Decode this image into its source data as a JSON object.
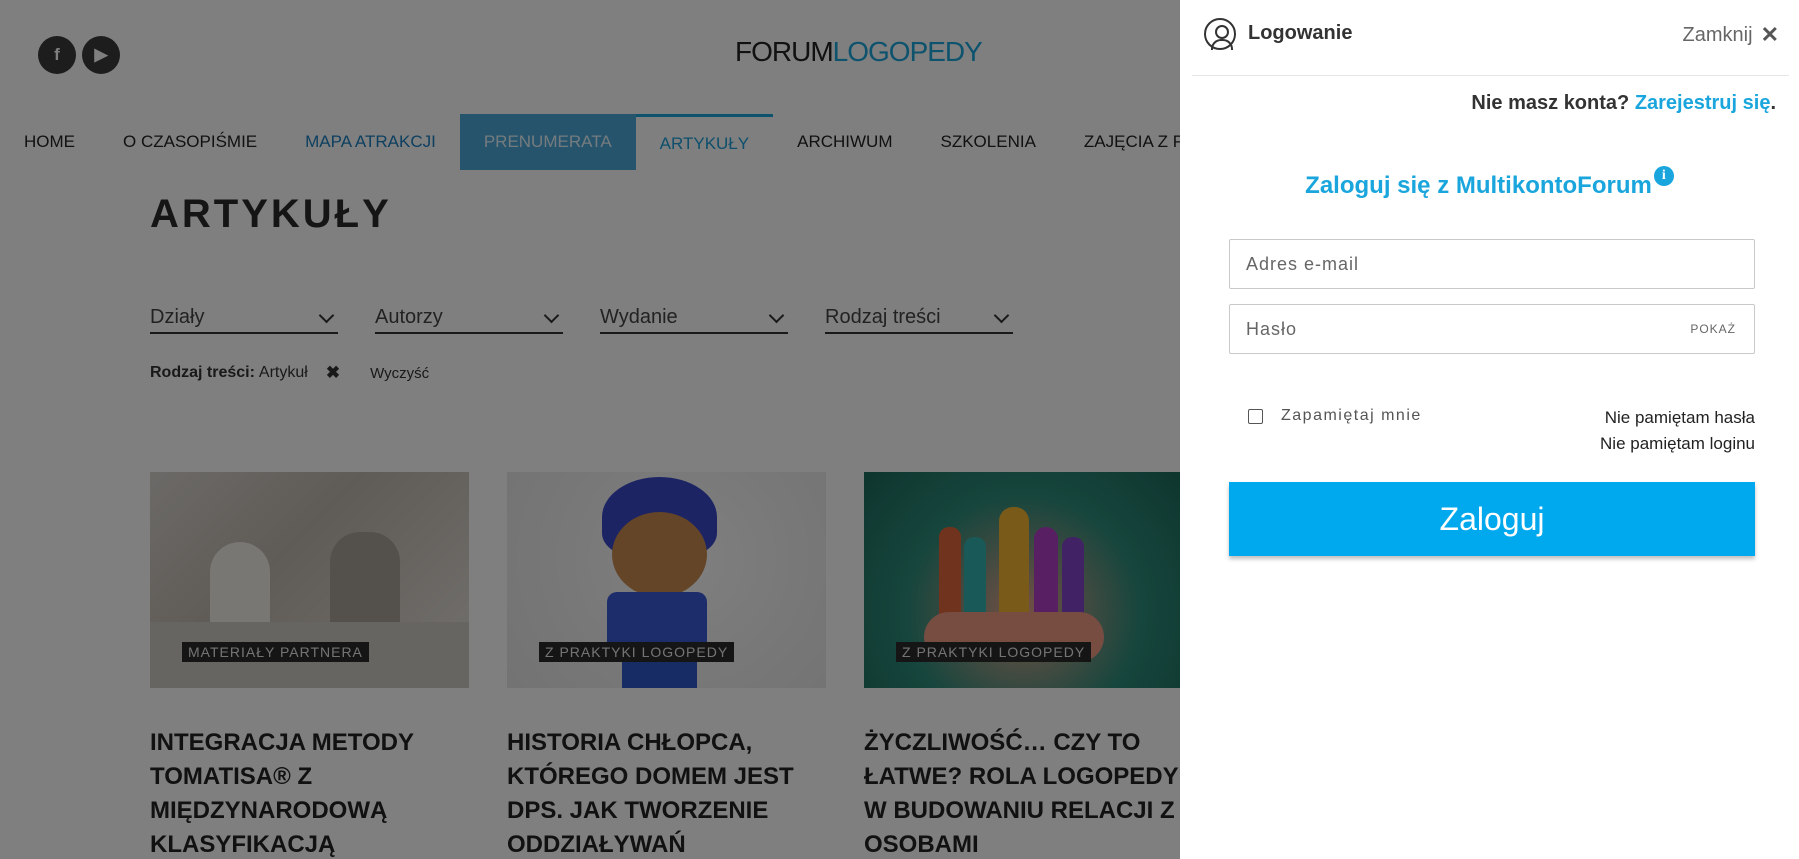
{
  "site": {
    "social": [
      {
        "icon": "facebook-icon",
        "glyph": "f"
      },
      {
        "icon": "youtube-icon",
        "glyph": "▶"
      }
    ],
    "logo": {
      "part1": "FORUM",
      "part2": "LOGOPEDY"
    },
    "nav": [
      "HOME",
      "O CZASOPIŚMIE",
      "MAPA ATRAKCJI",
      "PRENUMERATA",
      "ARTYKUŁY",
      "ARCHIWUM",
      "SZKOLENIA",
      "ZAJĘCIA Z PON"
    ],
    "page_title": "ARTYKUŁY",
    "filters": [
      "Działy",
      "Autorzy",
      "Wydanie",
      "Rodzaj treści"
    ],
    "active_filter": {
      "key": "Rodzaj treści:",
      "value": "Artykuł",
      "clear": "Wyczyść"
    },
    "cards": [
      {
        "tag": "MATERIAŁY PARTNERA",
        "title": "INTEGRACJA METODY TOMATISA® Z MIĘDZYNARODOWĄ KLASYFIKACJĄ"
      },
      {
        "tag": "Z PRAKTYKI LOGOPEDY",
        "title": "HISTORIA CHŁOPCA, KTÓREGO DOMEM JEST DPS. JAK TWORZENIE ODDZIAŁYWAŃ"
      },
      {
        "tag": "Z PRAKTYKI LOGOPEDY",
        "title": "ŻYCZLIWOŚĆ… CZY TO ŁATWE? ROLA LOGOPEDY W BUDOWANIU RELACJI Z OSOBAMI"
      }
    ]
  },
  "login": {
    "title": "Logowanie",
    "close": "Zamknij",
    "no_account": "Nie masz konta?",
    "register": "Zarejestruj się",
    "register_suffix": ".",
    "multikonto": "Zaloguj się z MultikontoForum",
    "info_glyph": "i",
    "email_placeholder": "Adres e-mail",
    "password_placeholder": "Hasło",
    "show": "POKAŻ",
    "remember": "Zapamiętaj mnie",
    "forgot_password": "Nie pamiętam hasła",
    "forgot_login": "Nie pamiętam loginu",
    "submit": "Zaloguj"
  },
  "colors": {
    "accent": "#1aa6dd",
    "button": "#00a8ee",
    "overlay": "rgba(0,0,0,0.5)"
  }
}
